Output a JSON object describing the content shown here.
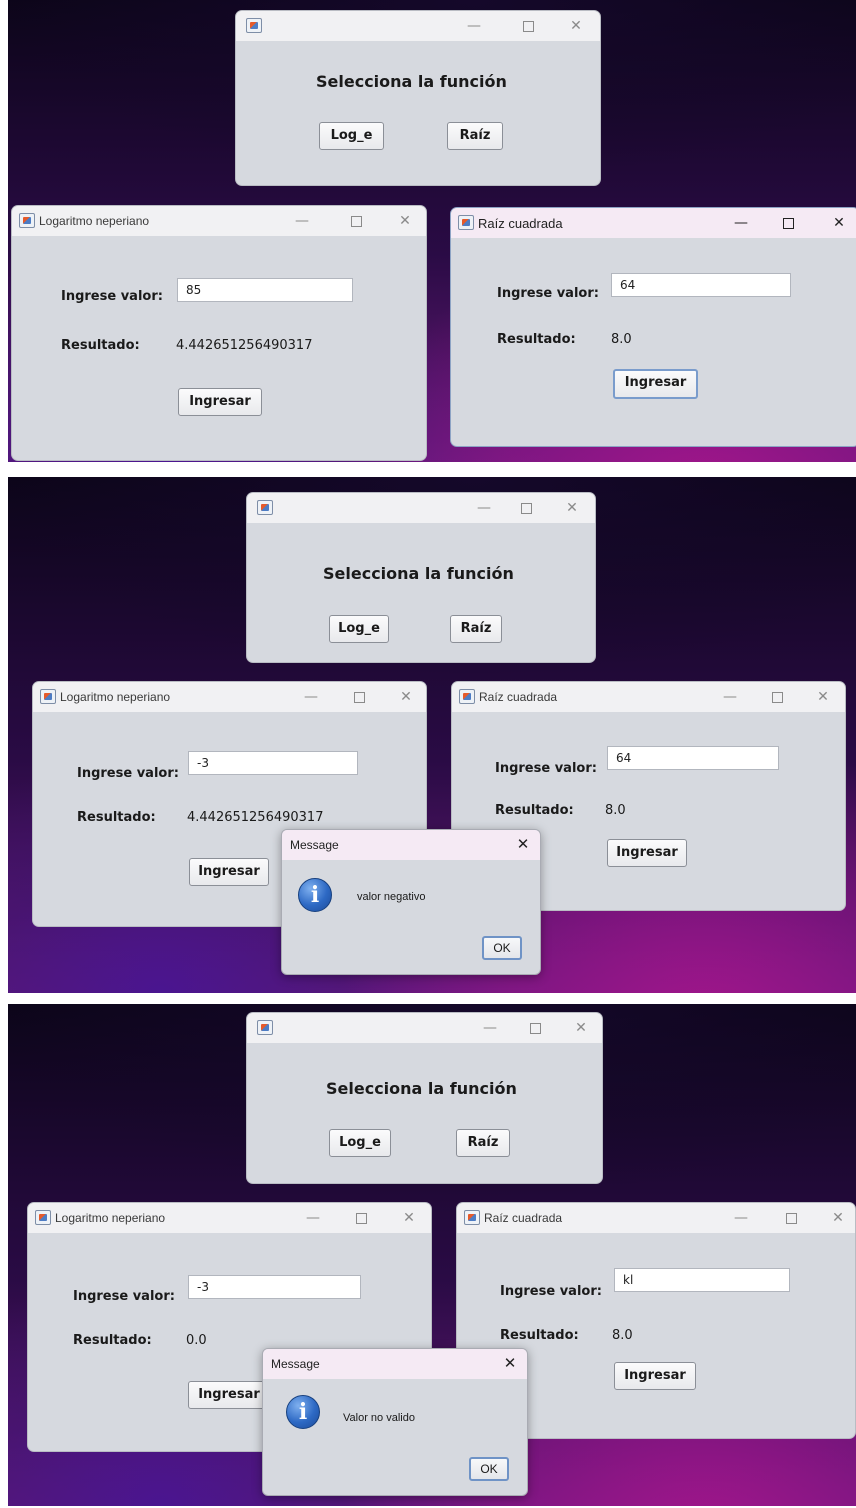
{
  "screens": [
    {
      "selector": {
        "heading": "Selecciona la función",
        "log_button": "Log_e",
        "raiz_button": "Raíz"
      },
      "log_window": {
        "title": "Logaritmo neperiano",
        "input_label": "Ingrese valor:",
        "input_value": "85",
        "result_label": "Resultado:",
        "result_value": "4.442651256490317",
        "submit_button": "Ingresar"
      },
      "sqrt_window": {
        "title": "Raíz cuadrada",
        "input_label": "Ingrese valor:",
        "input_value": "64",
        "result_label": "Resultado:",
        "result_value": "8.0",
        "submit_button": "Ingresar"
      }
    },
    {
      "selector": {
        "heading": "Selecciona la función",
        "log_button": "Log_e",
        "raiz_button": "Raíz"
      },
      "log_window": {
        "title": "Logaritmo neperiano",
        "input_label": "Ingrese valor:",
        "input_value": "-3",
        "result_label": "Resultado:",
        "result_value": "4.442651256490317",
        "submit_button": "Ingresar"
      },
      "sqrt_window": {
        "title": "Raíz cuadrada",
        "input_label": "Ingrese valor:",
        "input_value": "64",
        "result_label": "Resultado:",
        "result_value": "8.0",
        "submit_button": "Ingresar"
      },
      "dialog": {
        "title": "Message",
        "message": "valor negativo",
        "ok_button": "OK"
      }
    },
    {
      "selector": {
        "heading": "Selecciona la función",
        "log_button": "Log_e",
        "raiz_button": "Raíz"
      },
      "log_window": {
        "title": "Logaritmo neperiano",
        "input_label": "Ingrese valor:",
        "input_value": "-3",
        "result_label": "Resultado:",
        "result_value": "0.0",
        "submit_button": "Ingresar"
      },
      "sqrt_window": {
        "title": "Raíz cuadrada",
        "input_label": "Ingrese valor:",
        "input_value": "kl",
        "result_label": "Resultado:",
        "result_value": "8.0",
        "submit_button": "Ingresar"
      },
      "dialog": {
        "title": "Message",
        "message": "Valor no valido",
        "ok_button": "OK"
      }
    }
  ],
  "window_controls": {
    "minimize": "—",
    "close": "✕"
  },
  "icons": {
    "app": "java-app-icon",
    "info": "information-icon"
  },
  "colors": {
    "window_bg": "#d6d9df",
    "active_titlebar": "#f5eaf4",
    "inactive_titlebar": "#f1f1f3",
    "button_focus_border": "#7a9ccc",
    "info_icon": "#2d69c4"
  }
}
